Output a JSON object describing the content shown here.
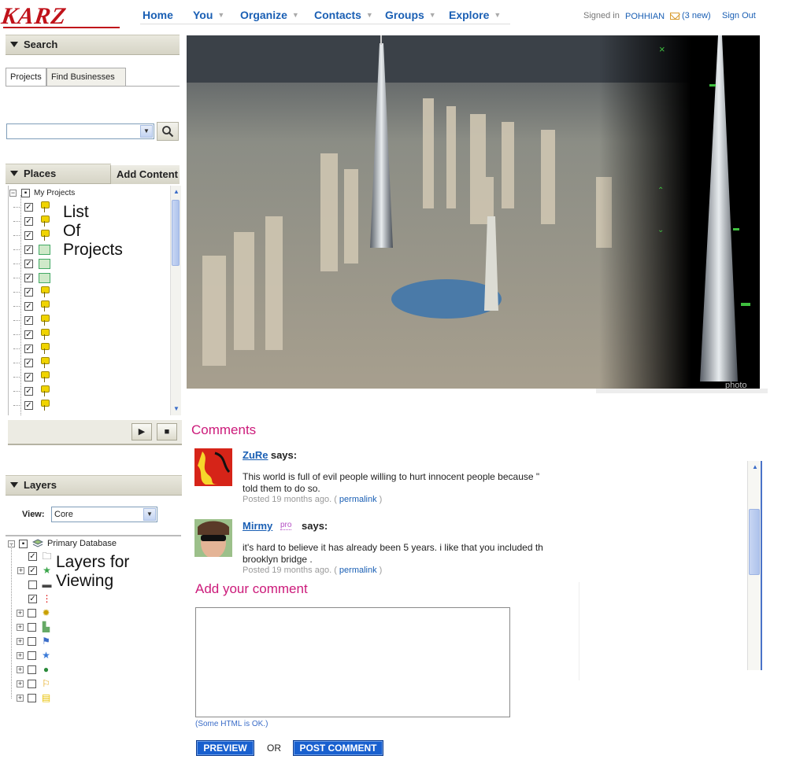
{
  "app": {
    "logo": "KARZ"
  },
  "nav": {
    "items": [
      {
        "label": "Home",
        "has_menu": false
      },
      {
        "label": "You",
        "has_menu": true
      },
      {
        "label": "Organize",
        "has_menu": true
      },
      {
        "label": "Contacts",
        "has_menu": true
      },
      {
        "label": "Groups",
        "has_menu": true
      },
      {
        "label": "Explore",
        "has_menu": true
      }
    ],
    "signed_in_label": "Signed in",
    "username": "POHHIAN",
    "mail_count": "(3 new)",
    "sign_out": "Sign Out"
  },
  "search_panel": {
    "title": "Search",
    "tabs": [
      "Projects",
      "Find Businesses"
    ],
    "active_tab": "Projects",
    "select_value": "",
    "button_icon": "magnifier-icon"
  },
  "places_panel": {
    "title": "Places",
    "add_content": "Add Content",
    "root_label": "My Projects",
    "list_label_line1": "List",
    "list_label_line2": "Of",
    "list_label_line3": "Projects",
    "item_icons": [
      "pushpin",
      "pushpin",
      "pushpin",
      "computer",
      "computer",
      "computer",
      "pushpin",
      "pushpin",
      "pushpin",
      "pushpin",
      "pushpin",
      "pushpin",
      "pushpin",
      "pushpin",
      "pushpin"
    ],
    "play_icon": "play-icon",
    "stop_icon": "stop-icon"
  },
  "layers_panel": {
    "title": "Layers",
    "view_label": "View:",
    "view_value": "Core",
    "root_label": "Primary Database",
    "label_line1": "Layers for",
    "label_line2": "Viewing",
    "layers": [
      {
        "icon": "folder-icon",
        "checked": true
      },
      {
        "icon": "star-icon",
        "checked": true
      },
      {
        "icon": "road-icon",
        "checked": false
      },
      {
        "icon": "traffic-light-icon",
        "checked": true
      },
      {
        "icon": "gear-icon",
        "checked": false
      },
      {
        "icon": "building-icon",
        "checked": false
      },
      {
        "icon": "flag-icon",
        "checked": false
      },
      {
        "icon": "blue-star-icon",
        "checked": false
      },
      {
        "icon": "globe-icon",
        "checked": false
      },
      {
        "icon": "pin-flag-icon",
        "checked": false
      },
      {
        "icon": "note-icon",
        "checked": false
      }
    ]
  },
  "photo": {
    "caption": "photo"
  },
  "comments": {
    "heading": "Comments",
    "items": [
      {
        "author": "ZuRe",
        "says": "says:",
        "text_line1": "This world is full of evil people willing to hurt innocent people because \"",
        "text_line2": "told them to do so.",
        "posted": "Posted 19 months ago. (",
        "permalink": "permalink",
        "close": ")",
        "pro": ""
      },
      {
        "author": "Mirmy",
        "says": "says:",
        "text_line1": "it's hard to believe it has already been 5 years. i like that you included th",
        "text_line2": "brooklyn bridge .",
        "posted": "Posted 19 months ago. (",
        "permalink": "permalink",
        "close": ")",
        "pro": "pro"
      }
    ]
  },
  "add_comment": {
    "heading": "Add your comment",
    "textarea_value": "",
    "html_note": "(Some HTML is OK.)",
    "preview": "PREVIEW",
    "or": "OR",
    "post": "POST COMMENT"
  },
  "colors": {
    "accent": "#1a5fb4",
    "heading": "#cc1a7a",
    "logo": "#c0121a",
    "button": "#1960cf"
  }
}
